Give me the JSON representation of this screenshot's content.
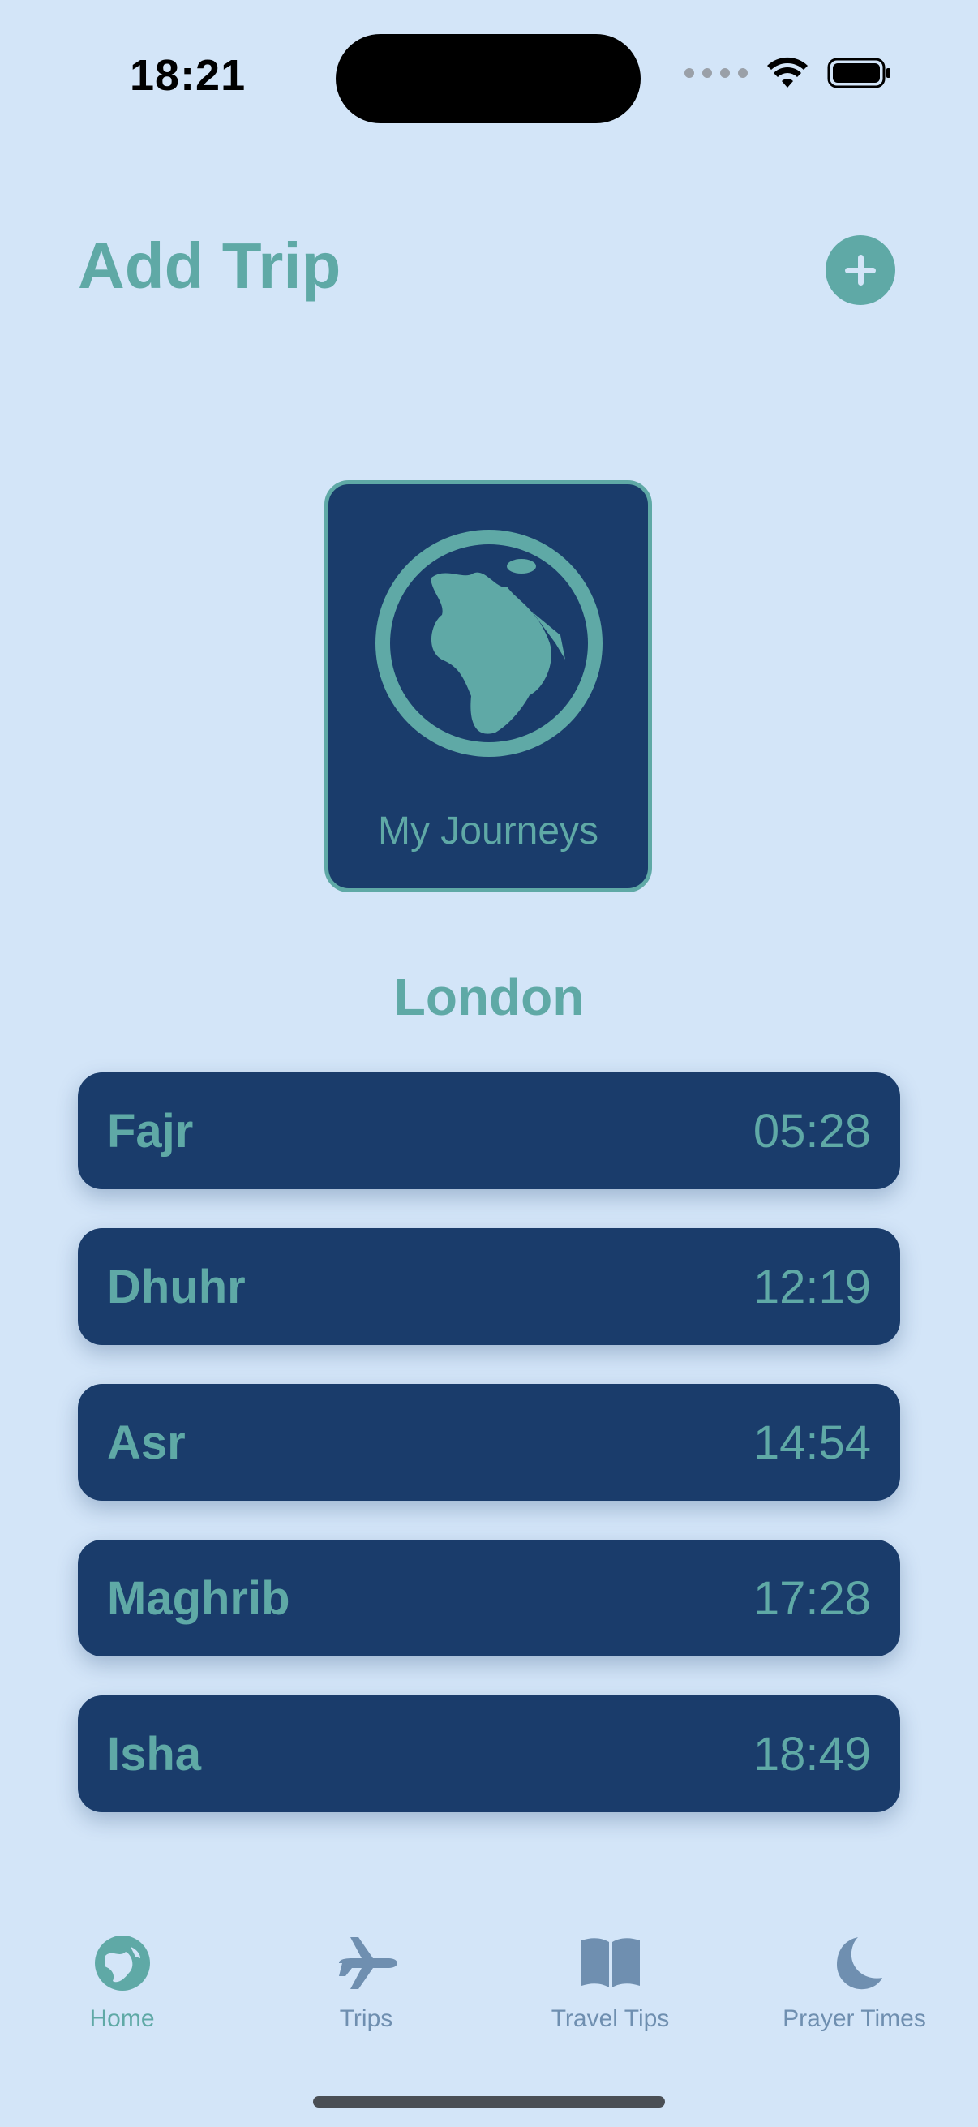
{
  "status_bar": {
    "time": "18:21"
  },
  "header": {
    "title": "Add Trip",
    "add_icon": "plus-circle-icon"
  },
  "journeys_card": {
    "label": "My Journeys",
    "icon": "globe-europe-africa-icon"
  },
  "location": {
    "city": "London"
  },
  "prayers": [
    {
      "name": "Fajr",
      "time": "05:28"
    },
    {
      "name": "Dhuhr",
      "time": "12:19"
    },
    {
      "name": "Asr",
      "time": "14:54"
    },
    {
      "name": "Maghrib",
      "time": "17:28"
    },
    {
      "name": "Isha",
      "time": "18:49"
    }
  ],
  "tabs": [
    {
      "label": "Home",
      "icon": "globe-icon",
      "active": true
    },
    {
      "label": "Trips",
      "icon": "airplane-icon",
      "active": false
    },
    {
      "label": "Travel Tips",
      "icon": "book-icon",
      "active": false
    },
    {
      "label": "Prayer Times",
      "icon": "moon-icon",
      "active": false
    }
  ],
  "colors": {
    "background": "#d3e5f8",
    "navy": "#1a3c6b",
    "teal": "#5fa9a6",
    "inactive": "#6f8fb0"
  }
}
